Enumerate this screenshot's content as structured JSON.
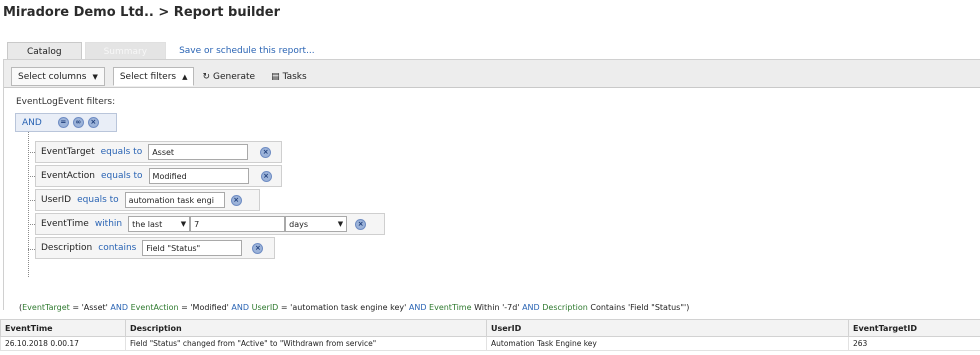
{
  "header": {
    "breadcrumb": "Miradore Demo Ltd.. > Report builder"
  },
  "tabs": {
    "catalog": "Catalog",
    "summary": "Summary",
    "save_link": "Save or schedule this report..."
  },
  "toolbar": {
    "select_columns": "Select columns",
    "select_filters": "Select filters",
    "generate": "Generate",
    "tasks": "Tasks"
  },
  "filters": {
    "label": "EventLogEvent filters:",
    "group_operator": "AND",
    "rows": [
      {
        "field": "EventTarget",
        "operator": "equals to",
        "value": "Asset"
      },
      {
        "field": "EventAction",
        "operator": "equals to",
        "value": "Modified"
      },
      {
        "field": "UserID",
        "operator": "equals to",
        "value": "automation task engi"
      },
      {
        "field": "EventTime",
        "operator": "within",
        "range": "the last",
        "value": "7",
        "unit": "days"
      },
      {
        "field": "Description",
        "operator": "contains",
        "value": "Field \"Status\""
      }
    ]
  },
  "expression": {
    "open": "(",
    "f1": "EventTarget",
    "t1": " = 'Asset' ",
    "and1": "AND",
    "f2": " EventAction",
    "t2": " = 'Modified' ",
    "and2": "AND",
    "f3": " UserID",
    "t3": " = 'automation task engine key' ",
    "and3": "AND",
    "f4": " EventTime",
    "t4": " Within '-7d' ",
    "and4": "AND",
    "f5": " Description",
    "t5": " Contains 'Field \"Status\"')"
  },
  "table": {
    "columns": [
      "EventTime",
      "Description",
      "UserID",
      "EventTargetID"
    ],
    "rows": [
      [
        "26.10.2018 0.00.17",
        "Field \"Status\" changed from \"Active\" to \"Withdrawn from service\"",
        "Automation Task Engine key",
        "263"
      ]
    ]
  },
  "colors": {
    "link": "#2a64b4",
    "field_green": "#2f7a2f"
  }
}
